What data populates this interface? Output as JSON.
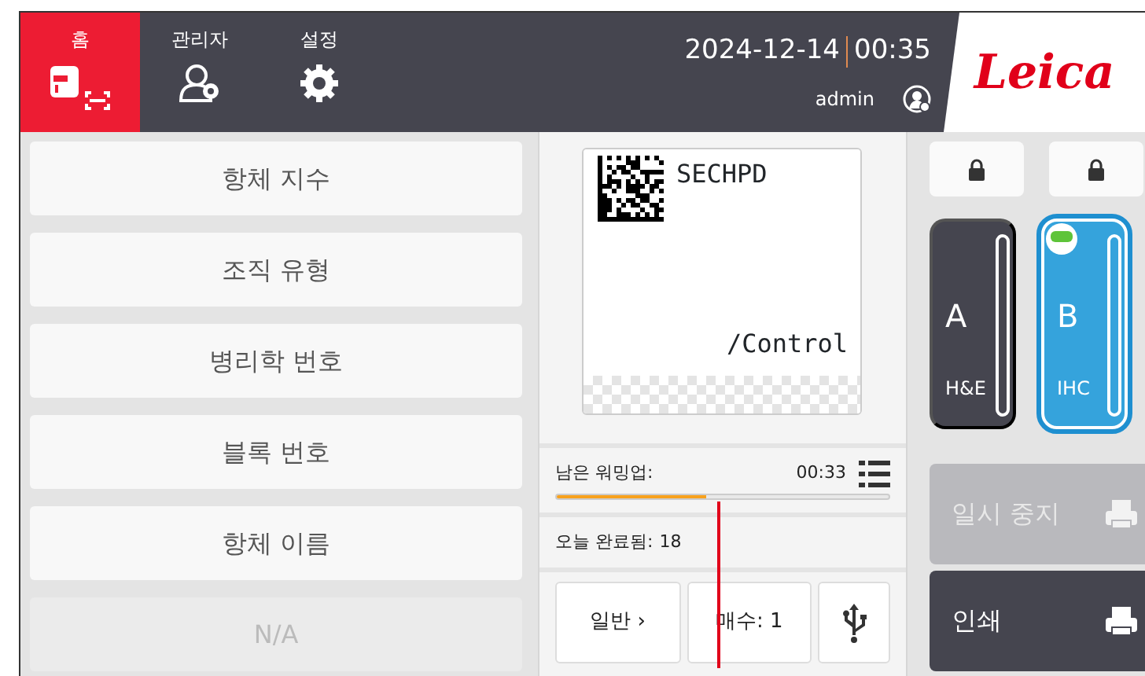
{
  "tabs": [
    {
      "label": "홈",
      "selected": true,
      "kind": "home"
    },
    {
      "label": "관리자",
      "selected": false,
      "kind": "admin"
    },
    {
      "label": "설정",
      "selected": false,
      "kind": "settings"
    }
  ],
  "header": {
    "date": "2024-12-14",
    "time": "00:35",
    "user": "admin",
    "logo": "Leica"
  },
  "fields": [
    {
      "label": "항체 지수",
      "disabled": false
    },
    {
      "label": "조직 유형",
      "disabled": false
    },
    {
      "label": "병리학 번호",
      "disabled": false
    },
    {
      "label": "블록 번호",
      "disabled": false
    },
    {
      "label": "항체 이름",
      "disabled": false
    },
    {
      "label": "N/A",
      "disabled": true
    }
  ],
  "slide_label": {
    "line_1": "SECHPD",
    "line_2": "/Control"
  },
  "warmup": {
    "label": "남은 워밍업:",
    "time": "00:33",
    "level": 0.45
  },
  "completed": {
    "label": "오늘 완료됨:",
    "count": "18"
  },
  "actions": [
    {
      "kind": "menu",
      "label": "일반",
      "chevron": "›"
    },
    {
      "kind": "text",
      "label": "매수: 1"
    },
    {
      "kind": "usb"
    }
  ],
  "reagents": [
    {
      "letter": "A",
      "type": "H&E",
      "locked": true,
      "selected": false,
      "status_light": false,
      "color": "#45454f"
    },
    {
      "letter": "B",
      "type": "IHC",
      "locked": true,
      "selected": true,
      "status_light": true,
      "color": "#35a3dc"
    }
  ],
  "print_buttons": [
    {
      "label": "일시 중지",
      "disabled": true
    },
    {
      "label": "인쇄",
      "disabled": false
    }
  ]
}
